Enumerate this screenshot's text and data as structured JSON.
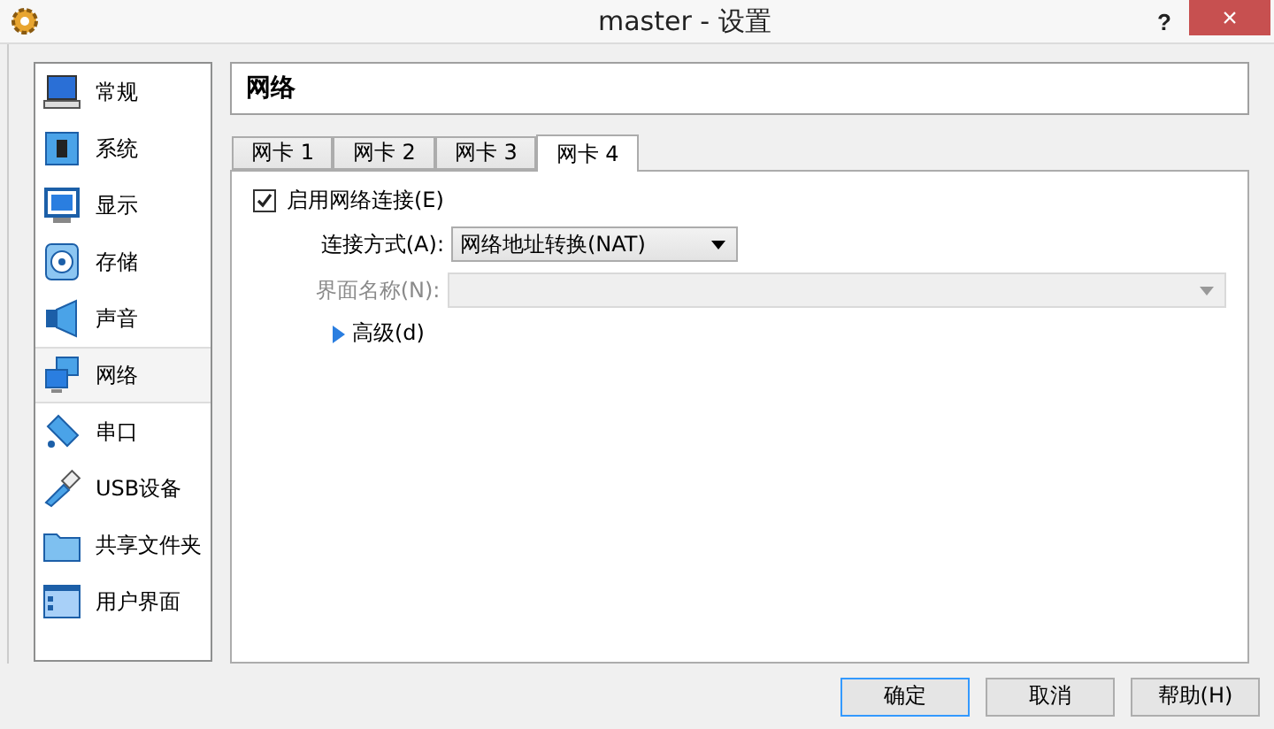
{
  "window": {
    "title": "master - 设置",
    "help": "?",
    "close": "×"
  },
  "sidebar": {
    "items": [
      {
        "label": "常规",
        "selected": false
      },
      {
        "label": "系统",
        "selected": false
      },
      {
        "label": "显示",
        "selected": false
      },
      {
        "label": "存储",
        "selected": false
      },
      {
        "label": "声音",
        "selected": false
      },
      {
        "label": "网络",
        "selected": true
      },
      {
        "label": "串口",
        "selected": false
      },
      {
        "label": "USB设备",
        "selected": false
      },
      {
        "label": "共享文件夹",
        "selected": false
      },
      {
        "label": "用户界面",
        "selected": false
      }
    ]
  },
  "page_title": "网络",
  "tabs": [
    {
      "label": "网卡 1",
      "selected": false
    },
    {
      "label": "网卡 2",
      "selected": false
    },
    {
      "label": "网卡 3",
      "selected": false
    },
    {
      "label": "网卡 4",
      "selected": true
    }
  ],
  "adapter": {
    "enable": {
      "label": "启用网络连接(E)",
      "checked": true
    },
    "attached": {
      "label": "连接方式(A):",
      "value": "网络地址转换(NAT)",
      "disabled": false
    },
    "name": {
      "label": "界面名称(N):",
      "disabled": true
    },
    "advanced": {
      "label": "高级(d)",
      "expanded": false
    }
  },
  "buttons": [
    {
      "label": "确定",
      "default": true
    },
    {
      "label": "取消",
      "default": false
    },
    {
      "label": "帮助(H)",
      "default": false
    }
  ]
}
